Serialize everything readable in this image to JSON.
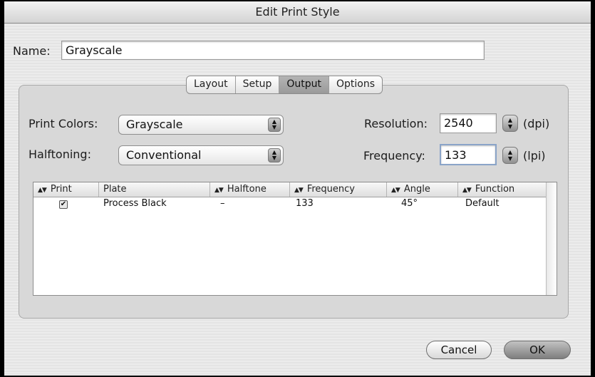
{
  "window": {
    "title": "Edit Print Style"
  },
  "name_field": {
    "label": "Name:",
    "value": "Grayscale"
  },
  "tabs": [
    {
      "label": "Layout"
    },
    {
      "label": "Setup"
    },
    {
      "label": "Output",
      "active": true
    },
    {
      "label": "Options"
    }
  ],
  "output": {
    "print_colors": {
      "label": "Print Colors:",
      "value": "Grayscale"
    },
    "halftoning": {
      "label": "Halftoning:",
      "value": "Conventional"
    },
    "resolution": {
      "label": "Resolution:",
      "value": "2540",
      "unit": "(dpi)"
    },
    "frequency": {
      "label": "Frequency:",
      "value": "133",
      "unit": "(lpi)"
    }
  },
  "table": {
    "columns": [
      "Print",
      "Plate",
      "Halftone",
      "Frequency",
      "Angle",
      "Function"
    ],
    "rows": [
      {
        "print": true,
        "print_mark": "✔",
        "plate": "Process Black",
        "halftone": "–",
        "frequency": "133",
        "angle": "45°",
        "function": "Default"
      }
    ]
  },
  "buttons": {
    "cancel": "Cancel",
    "ok": "OK"
  },
  "icons": {
    "popup_arrows": "updown-arrows-icon",
    "sort": "sort-arrows-icon"
  },
  "colors": {
    "window_bg": "#e8e8e8",
    "panel_bg": "#d8d8d8",
    "active_tab": "#a8a8a8"
  }
}
